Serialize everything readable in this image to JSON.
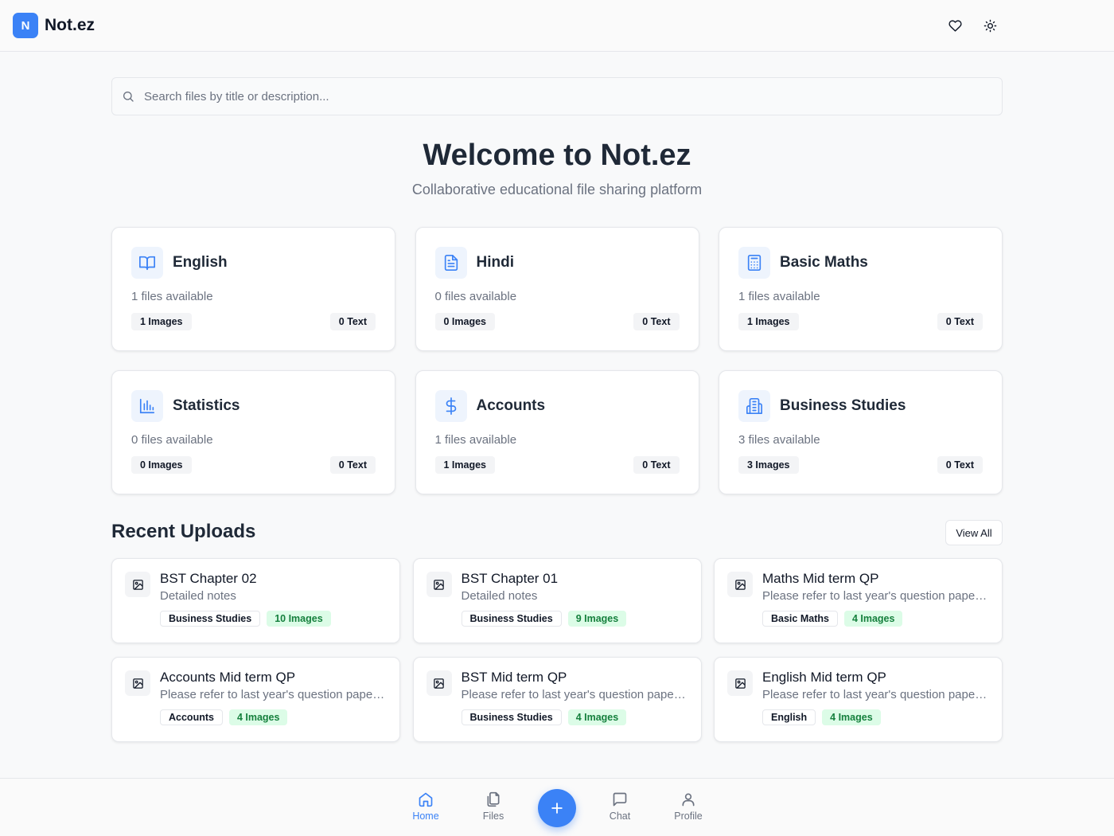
{
  "app": {
    "logo_letter": "N",
    "name": "Not.ez"
  },
  "header": {
    "actions": [
      {
        "icon": "heart-icon"
      },
      {
        "icon": "sun-icon"
      }
    ]
  },
  "search": {
    "placeholder": "Search files by title or description..."
  },
  "hero": {
    "title": "Welcome to Not.ez",
    "subtitle": "Collaborative educational file sharing platform"
  },
  "subjects": [
    {
      "name": "English",
      "icon": "book-open-icon",
      "count_text": "1 files available",
      "images": "1 Images",
      "text": "0 Text"
    },
    {
      "name": "Hindi",
      "icon": "file-text-icon",
      "count_text": "0 files available",
      "images": "0 Images",
      "text": "0 Text"
    },
    {
      "name": "Basic Maths",
      "icon": "calculator-icon",
      "count_text": "1 files available",
      "images": "1 Images",
      "text": "0 Text"
    },
    {
      "name": "Statistics",
      "icon": "bar-chart-icon",
      "count_text": "0 files available",
      "images": "0 Images",
      "text": "0 Text"
    },
    {
      "name": "Accounts",
      "icon": "dollar-icon",
      "count_text": "1 files available",
      "images": "1 Images",
      "text": "0 Text"
    },
    {
      "name": "Business Studies",
      "icon": "building-icon",
      "count_text": "3 files available",
      "images": "3 Images",
      "text": "0 Text"
    }
  ],
  "recent": {
    "title": "Recent Uploads",
    "view_all": "View All",
    "items": [
      {
        "title": "BST Chapter 02",
        "description": "Detailed notes",
        "subject": "Business Studies",
        "images": "10 Images"
      },
      {
        "title": "BST Chapter 01",
        "description": "Detailed notes",
        "subject": "Business Studies",
        "images": "9 Images"
      },
      {
        "title": "Maths Mid term QP",
        "description": "Please refer to last year's question paper for more practice",
        "subject": "Basic Maths",
        "images": "4 Images"
      },
      {
        "title": "Accounts Mid term QP",
        "description": "Please refer to last year's question paper for more practice",
        "subject": "Accounts",
        "images": "4 Images"
      },
      {
        "title": "BST Mid term QP",
        "description": "Please refer to last year's question paper for more practice",
        "subject": "Business Studies",
        "images": "4 Images"
      },
      {
        "title": "English Mid term QP",
        "description": "Please refer to last year's question paper for more practice",
        "subject": "English",
        "images": "4 Images"
      }
    ]
  },
  "nav": {
    "items": [
      {
        "label": "Home",
        "icon": "home-icon",
        "active": true
      },
      {
        "label": "Files",
        "icon": "files-icon",
        "active": false
      },
      {
        "label": "Chat",
        "icon": "chat-icon",
        "active": false
      },
      {
        "label": "Profile",
        "icon": "user-icon",
        "active": false
      }
    ],
    "fab_icon": "plus-icon"
  },
  "colors": {
    "accent": "#3b82f6",
    "success_bg": "#dcfce7",
    "success_text": "#15803d"
  }
}
